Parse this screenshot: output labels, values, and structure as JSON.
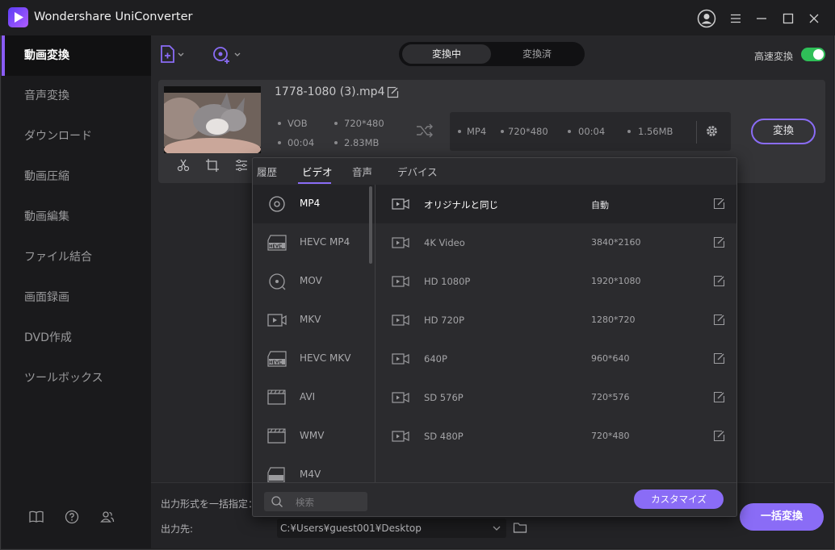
{
  "app": {
    "title": "Wondershare UniConverter"
  },
  "sidebar": {
    "items": [
      {
        "label": "動画変換",
        "active": true
      },
      {
        "label": "音声変換"
      },
      {
        "label": "ダウンロード"
      },
      {
        "label": "動画圧縮"
      },
      {
        "label": "動画編集"
      },
      {
        "label": "ファイル結合"
      },
      {
        "label": "画面録画"
      },
      {
        "label": "DVD作成"
      },
      {
        "label": "ツールボックス"
      }
    ],
    "footer_icons": [
      "book-icon",
      "help-icon",
      "users-icon"
    ]
  },
  "toolbar": {
    "tabs": [
      "変換中",
      "変換済"
    ],
    "active_tab": "変換中",
    "high_speed_label": "高速変換",
    "high_speed_on": true
  },
  "file": {
    "name": "1778-1080 (3).mp4",
    "source": {
      "format": "VOB",
      "resolution": "720*480",
      "duration": "00:04",
      "size": "2.83MB"
    },
    "target": {
      "format": "MP4",
      "resolution": "720*480",
      "duration": "00:04",
      "size": "1.56MB"
    },
    "convert_label": "変換"
  },
  "popup": {
    "tabs": [
      "履歴",
      "ビデオ",
      "音声",
      "デバイス"
    ],
    "active_tab": "ビデオ",
    "formats": [
      {
        "label": "MP4",
        "icon": "mp4-disc-icon"
      },
      {
        "label": "HEVC MP4",
        "icon": "hevc-icon"
      },
      {
        "label": "MOV",
        "icon": "mov-icon"
      },
      {
        "label": "MKV",
        "icon": "mkv-video-icon"
      },
      {
        "label": "HEVC MKV",
        "icon": "hevc-icon"
      },
      {
        "label": "AVI",
        "icon": "clapper-icon"
      },
      {
        "label": "WMV",
        "icon": "clapper-icon"
      },
      {
        "label": "M4V",
        "icon": "m4v-icon"
      }
    ],
    "resolutions": [
      {
        "label": "オリジナルと同じ",
        "value": "自動"
      },
      {
        "label": "4K Video",
        "value": "3840*2160"
      },
      {
        "label": "HD 1080P",
        "value": "1920*1080"
      },
      {
        "label": "HD 720P",
        "value": "1280*720"
      },
      {
        "label": "640P",
        "value": "960*640"
      },
      {
        "label": "SD 576P",
        "value": "720*576"
      },
      {
        "label": "SD 480P",
        "value": "720*480"
      }
    ],
    "search_placeholder": "検索",
    "customize_label": "カスタマイズ"
  },
  "bottom": {
    "format_label": "出力形式を一括指定：",
    "dest_label": "出力先:",
    "dest_path": "C:¥Users¥guest001¥Desktop",
    "convert_all_label": "一括変換"
  },
  "colors": {
    "accent": "#8a6cf6",
    "toggle_on": "#2fbf58"
  }
}
